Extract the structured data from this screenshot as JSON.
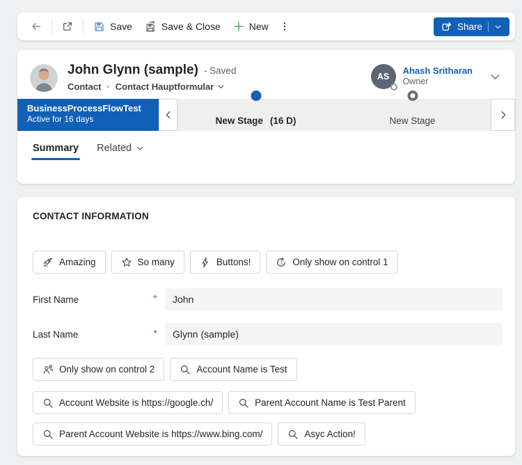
{
  "colors": {
    "accent_blue": "#1160b7",
    "new_green": "#5aa660",
    "required_red": "#a4262c",
    "recommended_blue": "#0f6cbd",
    "input_bg": "#f5f5f5",
    "bpf_track_bg": "#efefef",
    "card_bg": "#ffffff",
    "page_bg": "#eef0f1"
  },
  "toolbar": {
    "save_label": "Save",
    "save_close_label": "Save & Close",
    "new_label": "New",
    "share_label": "Share"
  },
  "header": {
    "title": "John Glynn (sample)",
    "save_status": "- Saved",
    "entity": "Contact",
    "separator": "·",
    "form_name": "Contact Hauptformular",
    "owner": {
      "initials": "AS",
      "name": "Ahash Sritharan",
      "role": "Owner"
    }
  },
  "bpf": {
    "name": "BusinessProcessFlowTest",
    "status": "Active for 16 days",
    "stages": [
      {
        "label": "New Stage",
        "duration": "(16 D)",
        "active": true
      },
      {
        "label": "New Stage",
        "duration": "",
        "active": false
      }
    ]
  },
  "tabs": [
    {
      "label": "Summary",
      "active": true
    },
    {
      "label": "Related",
      "active": false
    }
  ],
  "section": {
    "title": "CONTACT INFORMATION"
  },
  "fields": [
    {
      "label": "First Name",
      "marker": "+",
      "marker_type": "business-recommended",
      "value": "John"
    },
    {
      "label": "Last Name",
      "marker": "*",
      "marker_type": "required",
      "value": "Glynn (sample)"
    }
  ],
  "actions": {
    "row1": [
      {
        "icon": "rocket",
        "label": "Amazing"
      },
      {
        "icon": "star",
        "label": "So many"
      },
      {
        "icon": "lightning",
        "label": "Buttons!"
      },
      {
        "icon": "arrow-repeat-1",
        "label": "Only show on control 1"
      }
    ],
    "row2": [
      {
        "icon": "people",
        "label": "Only show on control 2"
      },
      {
        "icon": "search",
        "label": "Account Name is Test"
      }
    ],
    "row3": [
      {
        "icon": "search",
        "label": "Account Website is https://google.ch/"
      },
      {
        "icon": "search",
        "label": "Parent Account Name is Test Parent"
      }
    ],
    "row4": [
      {
        "icon": "search",
        "label": "Parent Account Website is https://www.bing.com/"
      },
      {
        "icon": "search",
        "label": "Asyc Action!"
      }
    ]
  }
}
